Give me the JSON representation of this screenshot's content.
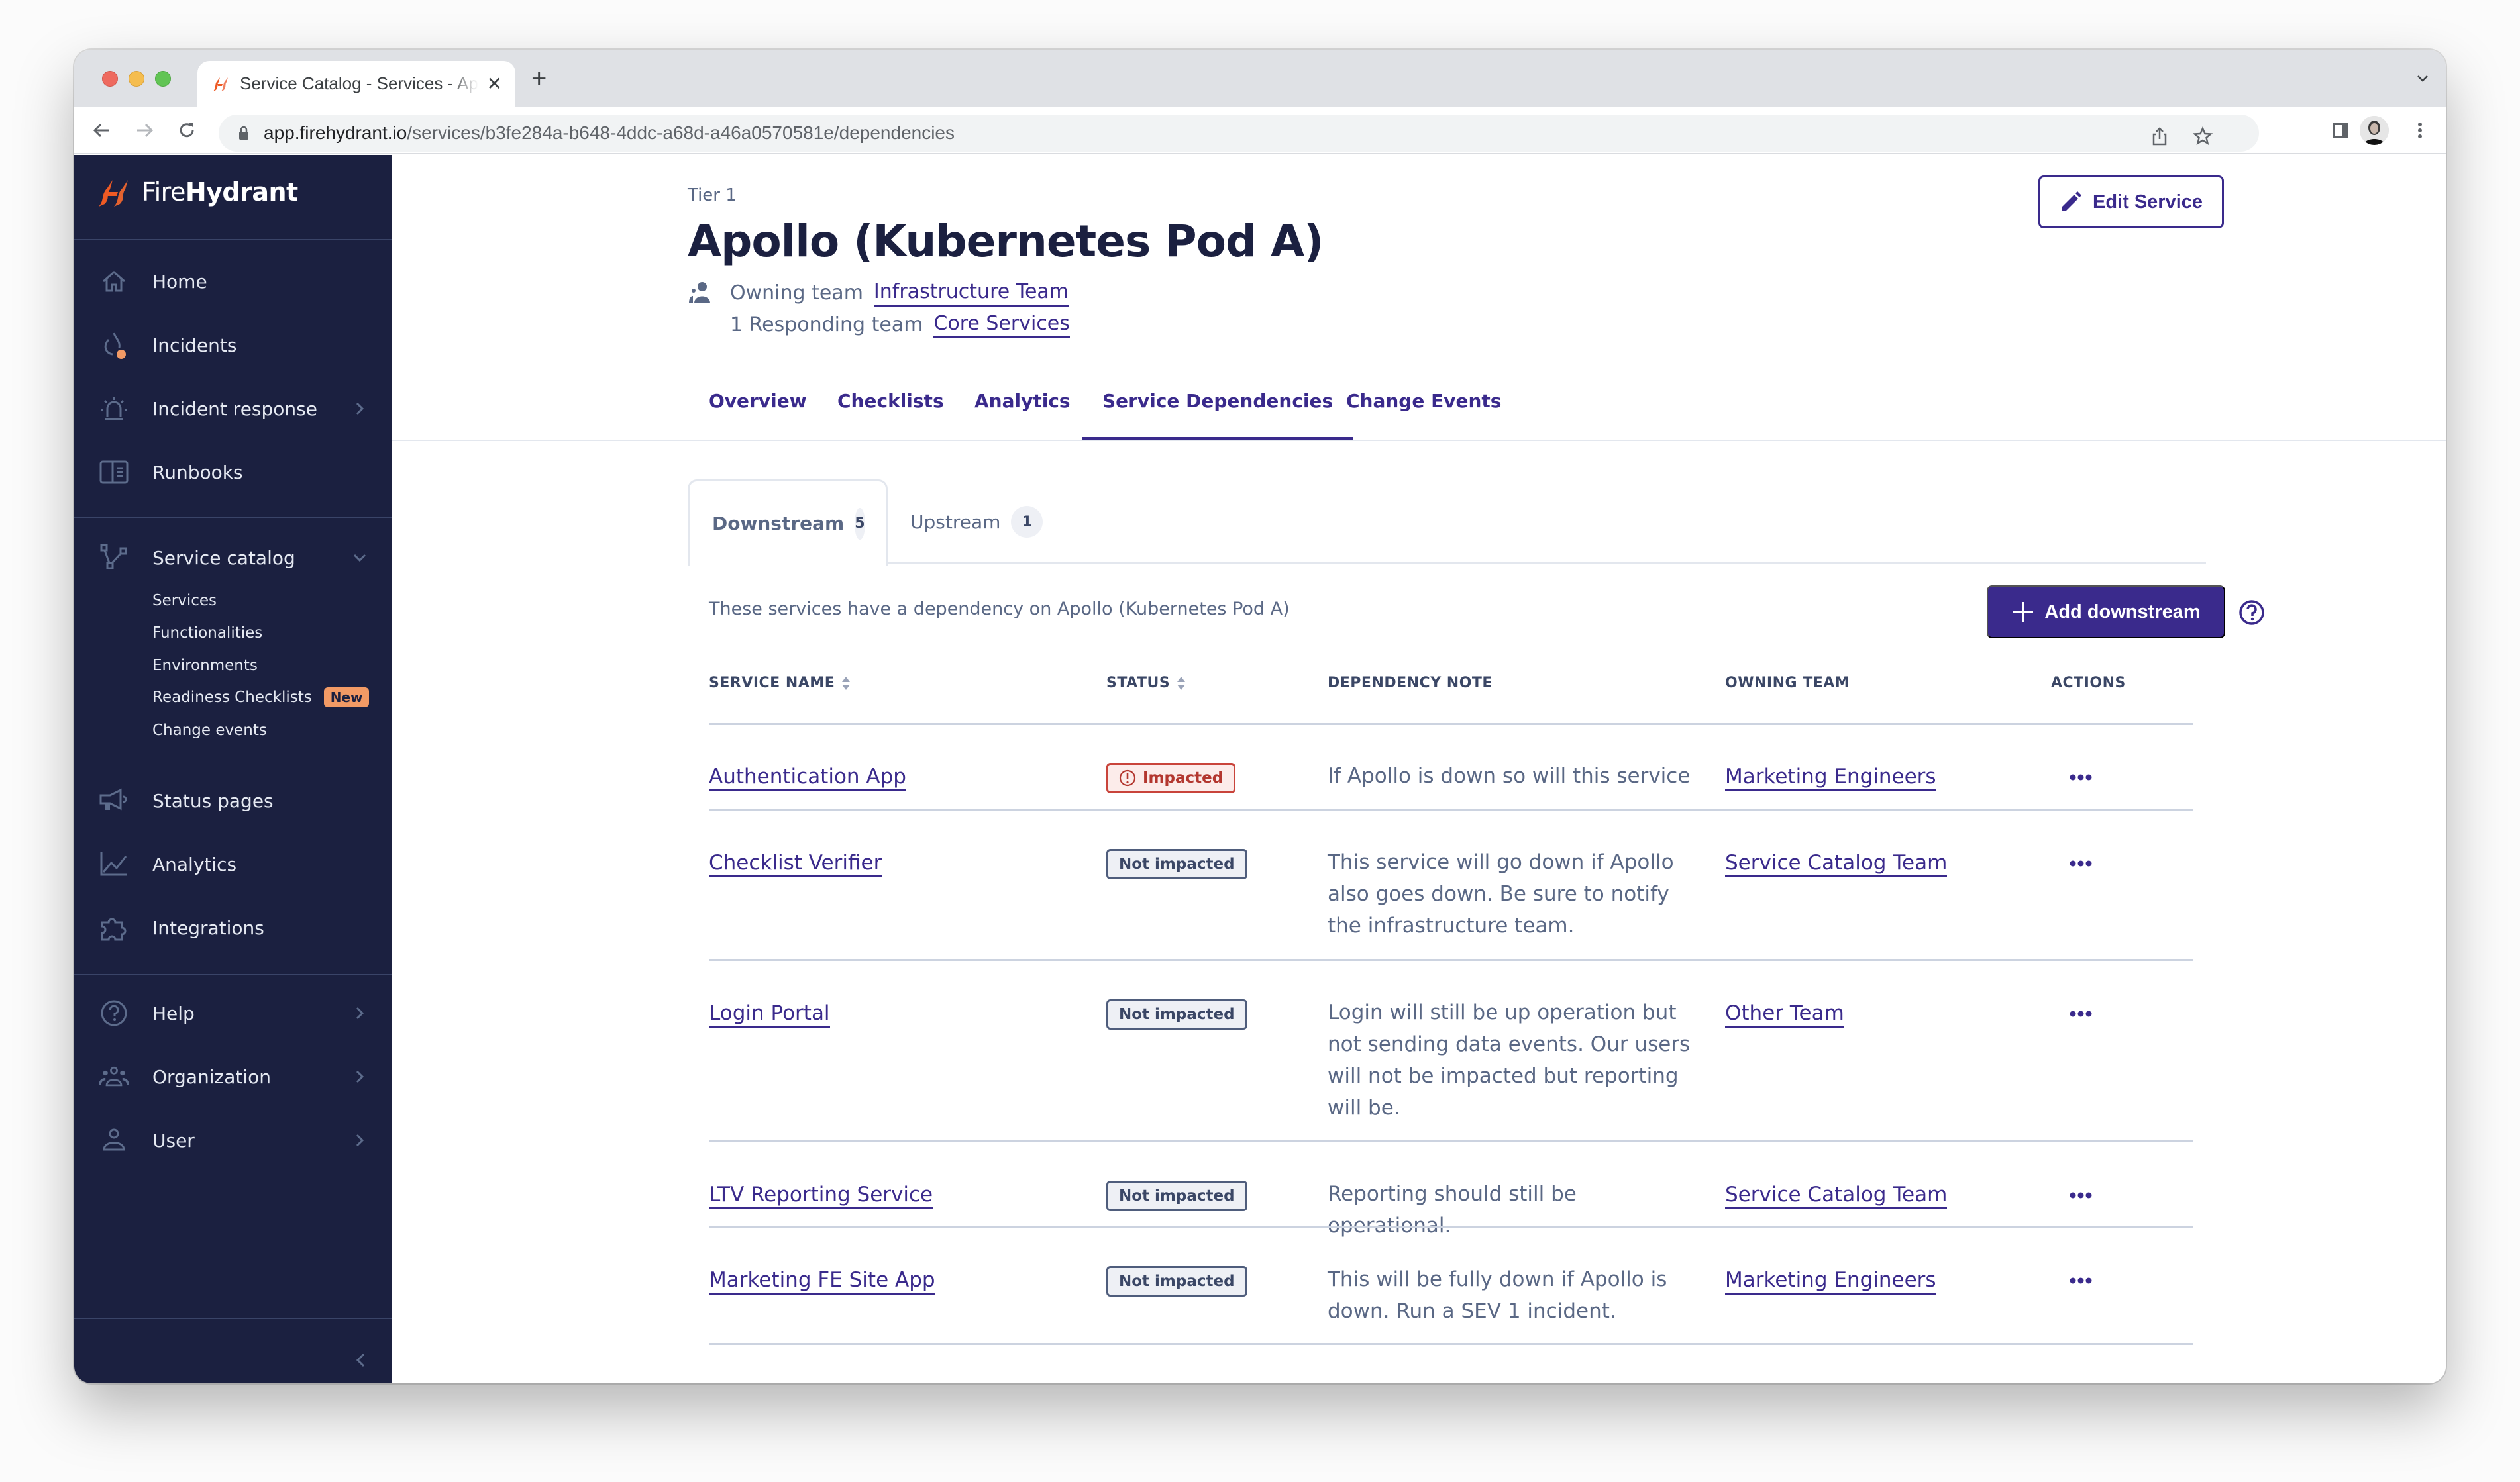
{
  "browser": {
    "tab_title": "Service Catalog - Services - Apollo (Kubernetes Pod A)",
    "new_tab_icon": "plus-icon",
    "url_host": "app.firehydrant.io",
    "url_path": "/services/b3fe284a-b648-4ddc-a68d-a46a0570581e/dependencies"
  },
  "sidebar": {
    "brand_light": "Fire",
    "brand_bold": "Hydrant",
    "items": [
      {
        "label": "Home",
        "icon": "home-icon"
      },
      {
        "label": "Incidents",
        "icon": "flame-icon"
      },
      {
        "label": "Incident response",
        "icon": "siren-icon"
      },
      {
        "label": "Runbooks",
        "icon": "book-icon"
      },
      {
        "label": "Service catalog",
        "icon": "graph-icon"
      },
      {
        "label": "Status pages",
        "icon": "megaphone-icon"
      },
      {
        "label": "Analytics",
        "icon": "chart-icon"
      },
      {
        "label": "Integrations",
        "icon": "puzzle-icon"
      },
      {
        "label": "Help",
        "icon": "help-icon"
      },
      {
        "label": "Organization",
        "icon": "people-icon"
      },
      {
        "label": "User",
        "icon": "user-icon"
      }
    ],
    "service_catalog_sub": [
      "Services",
      "Functionalities",
      "Environments",
      "Readiness Checklists",
      "Change events"
    ],
    "new_badge": "New"
  },
  "service": {
    "tier": "Tier 1",
    "name": "Apollo (Kubernetes Pod A)",
    "owning_label": "Owning team",
    "owning_team": "Infrastructure Team",
    "responding_label": "1 Responding team",
    "responding_team": "Core Services",
    "edit_label": "Edit Service"
  },
  "tabs": [
    "Overview",
    "Checklists",
    "Analytics",
    "Service Dependencies",
    "Change Events"
  ],
  "active_tab": "Service Dependencies",
  "subtabs": [
    {
      "label": "Downstream",
      "count": "5"
    },
    {
      "label": "Upstream",
      "count": "1"
    }
  ],
  "dependencies": {
    "description": "These services have a dependency on Apollo (Kubernetes Pod A)",
    "add_label": "Add downstream",
    "columns": [
      "SERVICE NAME",
      "STATUS",
      "DEPENDENCY NOTE",
      "OWNING TEAM",
      "ACTIONS"
    ],
    "rows": [
      {
        "service": "Authentication App",
        "status": "Impacted",
        "impacted": true,
        "note": "If Apollo is down so will this service",
        "team": "Marketing Engineers"
      },
      {
        "service": "Checklist Verifier",
        "status": "Not impacted",
        "impacted": false,
        "note": "This service will go down if Apollo also goes down. Be sure to notify the infrastructure team.",
        "team": "Service Catalog Team"
      },
      {
        "service": "Login Portal",
        "status": "Not impacted",
        "impacted": false,
        "note": "Login will still be up operation but not sending data events. Our users will not be impacted but reporting will be.",
        "team": "Other Team"
      },
      {
        "service": "LTV Reporting Service",
        "status": "Not impacted",
        "impacted": false,
        "note": "Reporting should still be operational.",
        "team": "Service Catalog Team"
      },
      {
        "service": "Marketing FE Site App",
        "status": "Not impacted",
        "impacted": false,
        "note": "This will be fully down if Apollo is down. Run a SEV 1 incident.",
        "team": "Marketing Engineers"
      }
    ]
  },
  "colors": {
    "sidebar_bg": "#1b2040",
    "accent": "#3a2a8c",
    "brand_orange": "#ee5a24",
    "impacted_red": "#c9443b",
    "muted_text": "#5a6885"
  }
}
